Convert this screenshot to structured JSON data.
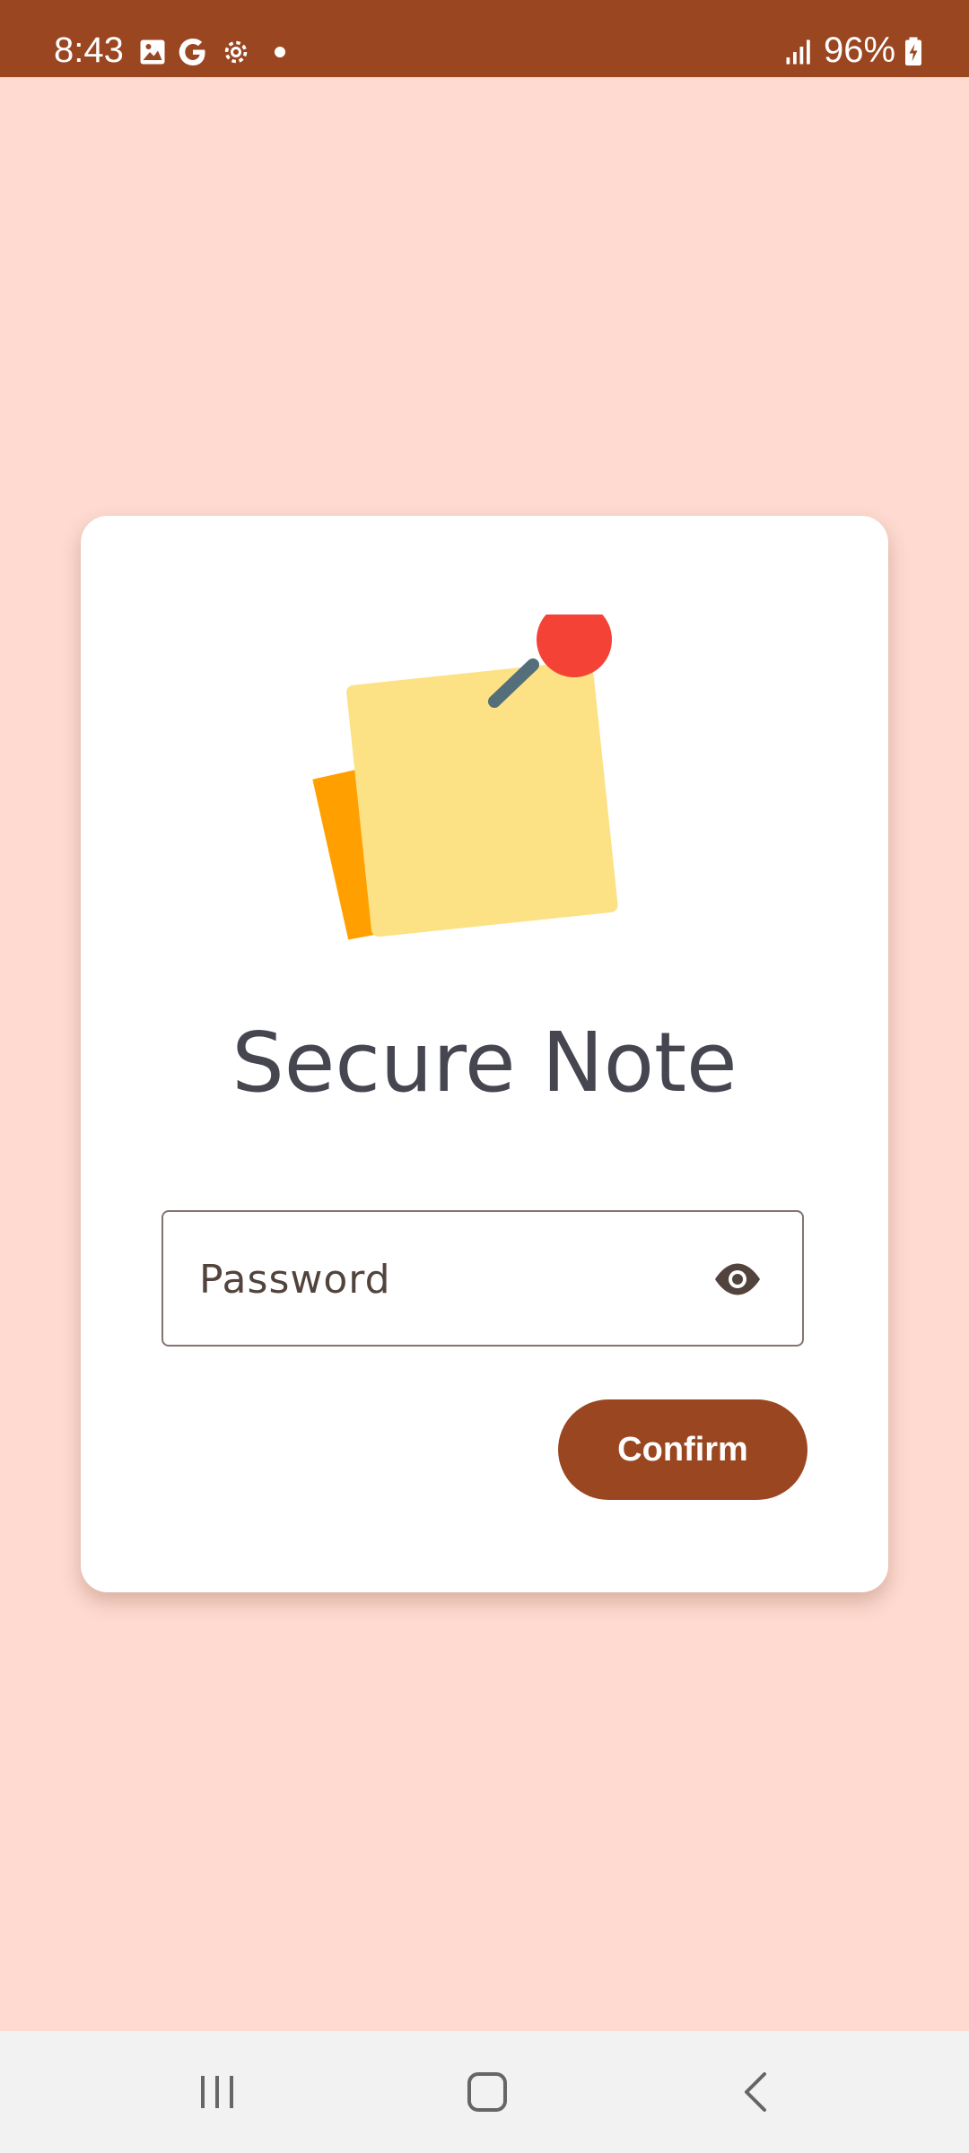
{
  "status_bar": {
    "time": "8:43",
    "battery": "96%",
    "icons": [
      "image-icon",
      "google-icon",
      "settings-icon",
      "dot-icon",
      "signal-icon",
      "battery-charging-icon"
    ],
    "background_color": "#9a4621"
  },
  "app": {
    "title": "Secure Note",
    "logo_icon": "sticky-note-pin-icon"
  },
  "password_field": {
    "placeholder": "Password",
    "value": "",
    "toggle_icon": "eye-icon"
  },
  "actions": {
    "confirm_label": "Confirm"
  },
  "nav_bar": {
    "items": [
      "recent-apps-icon",
      "home-icon",
      "back-icon"
    ]
  },
  "colors": {
    "background": "#fedad0",
    "card": "#ffffff",
    "accent": "#9a4621",
    "title_text": "#454650",
    "note_back": "#ffa000",
    "note_front": "#fde185",
    "pin_head": "#f44336",
    "pin_needle": "#546e7a"
  }
}
